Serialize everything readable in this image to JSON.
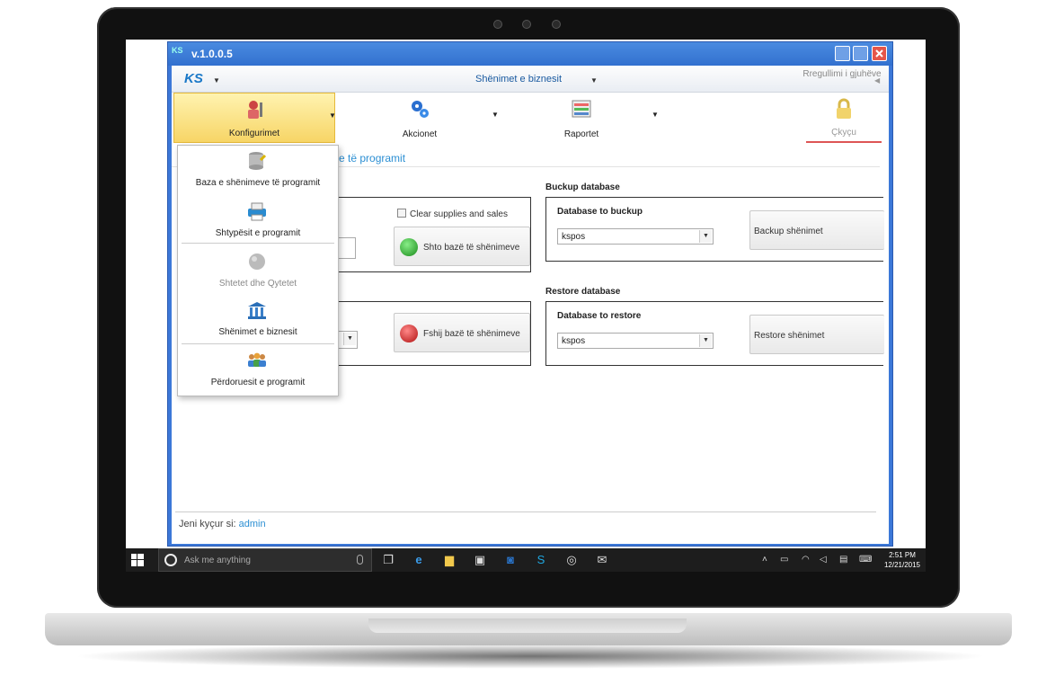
{
  "window": {
    "title": "v.1.0.0.5",
    "logo_text": "KS"
  },
  "menubar": {
    "logo_text": "KS",
    "center_label": "Shënimet e biznesit",
    "language_label": "Rregullimi i gjuhëve"
  },
  "ribbon": {
    "items": [
      {
        "label": "Konfigurimet",
        "icon": "person-tools-icon"
      },
      {
        "label": "Akcionet",
        "icon": "gears-icon"
      },
      {
        "label": "Raportet",
        "icon": "report-icon"
      },
      {
        "label": "Çkyçu",
        "icon": "lock-icon"
      }
    ]
  },
  "page": {
    "link_text": "ve të programit",
    "clear_checkbox": "Clear supplies and sales",
    "add_button": "Shto bazë të shënimeve",
    "delete_button": "Fshij bazë të shënimeve",
    "backup": {
      "section": "Buckup database",
      "field_label": "Database to buckup",
      "value": "kspos",
      "button": "Backup shënimet"
    },
    "restore": {
      "section": "Restore database",
      "field_label": "Database to restore",
      "value": "kspos",
      "button": "Restore shënimet"
    }
  },
  "dropdown": {
    "items": [
      {
        "label": "Baza e shënimeve të programit",
        "icon": "database-icon",
        "enabled": true
      },
      {
        "label": "Shtypësit e programit",
        "icon": "printer-icon",
        "enabled": true
      },
      {
        "label": "Shtetet dhe Qytetet",
        "icon": "globe-icon",
        "enabled": false
      },
      {
        "label": "Shënimet e biznesit",
        "icon": "bank-icon",
        "enabled": true
      },
      {
        "label": "Përdoruesit e programit",
        "icon": "users-icon",
        "enabled": true
      }
    ]
  },
  "status": {
    "label": "Jeni kyçur si:",
    "user": "admin"
  },
  "taskbar": {
    "search_placeholder": "Ask me anything",
    "time": "2:51 PM",
    "date": "12/21/2015"
  },
  "colors": {
    "window_blue": "#3c78d8",
    "link_blue": "#2c8fd3",
    "ribbon_active": "#f7d566"
  }
}
